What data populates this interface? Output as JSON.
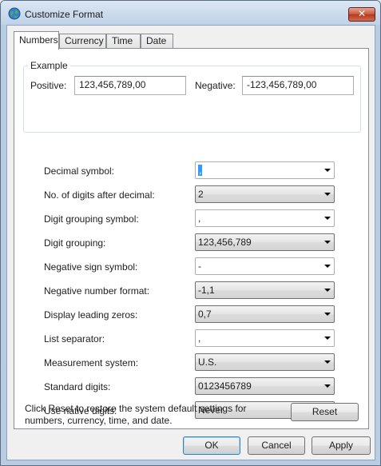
{
  "window": {
    "title": "Customize Format",
    "close_glyph": "✕",
    "icon": "globe-icon"
  },
  "tabs": [
    {
      "label": "Numbers",
      "active": true
    },
    {
      "label": "Currency",
      "active": false
    },
    {
      "label": "Time",
      "active": false
    },
    {
      "label": "Date",
      "active": false
    }
  ],
  "example": {
    "legend": "Example",
    "positive_label": "Positive:",
    "positive_value": "123,456,789,00",
    "negative_label": "Negative:",
    "negative_value": "-123,456,789,00"
  },
  "settings": [
    {
      "label": "Decimal symbol:",
      "value": ",",
      "kind": "edit",
      "selected": true
    },
    {
      "label": "No. of digits after decimal:",
      "value": "2",
      "kind": "list"
    },
    {
      "label": "Digit grouping symbol:",
      "value": ",",
      "kind": "edit"
    },
    {
      "label": "Digit grouping:",
      "value": "123,456,789",
      "kind": "list"
    },
    {
      "label": "Negative sign symbol:",
      "value": "-",
      "kind": "edit"
    },
    {
      "label": "Negative number format:",
      "value": "-1,1",
      "kind": "list"
    },
    {
      "label": "Display leading zeros:",
      "value": "0,7",
      "kind": "list"
    },
    {
      "label": "List separator:",
      "value": ",",
      "kind": "edit"
    },
    {
      "label": "Measurement system:",
      "value": "U.S.",
      "kind": "list"
    },
    {
      "label": "Standard digits:",
      "value": "0123456789",
      "kind": "list"
    },
    {
      "label": "Use native digits:",
      "value": "Never",
      "kind": "list"
    }
  ],
  "footer": {
    "info": "Click Reset to restore the system default settings for numbers, currency, time, and date.",
    "reset_label": "Reset",
    "ok_label": "OK",
    "cancel_label": "Cancel",
    "apply_label": "Apply"
  }
}
